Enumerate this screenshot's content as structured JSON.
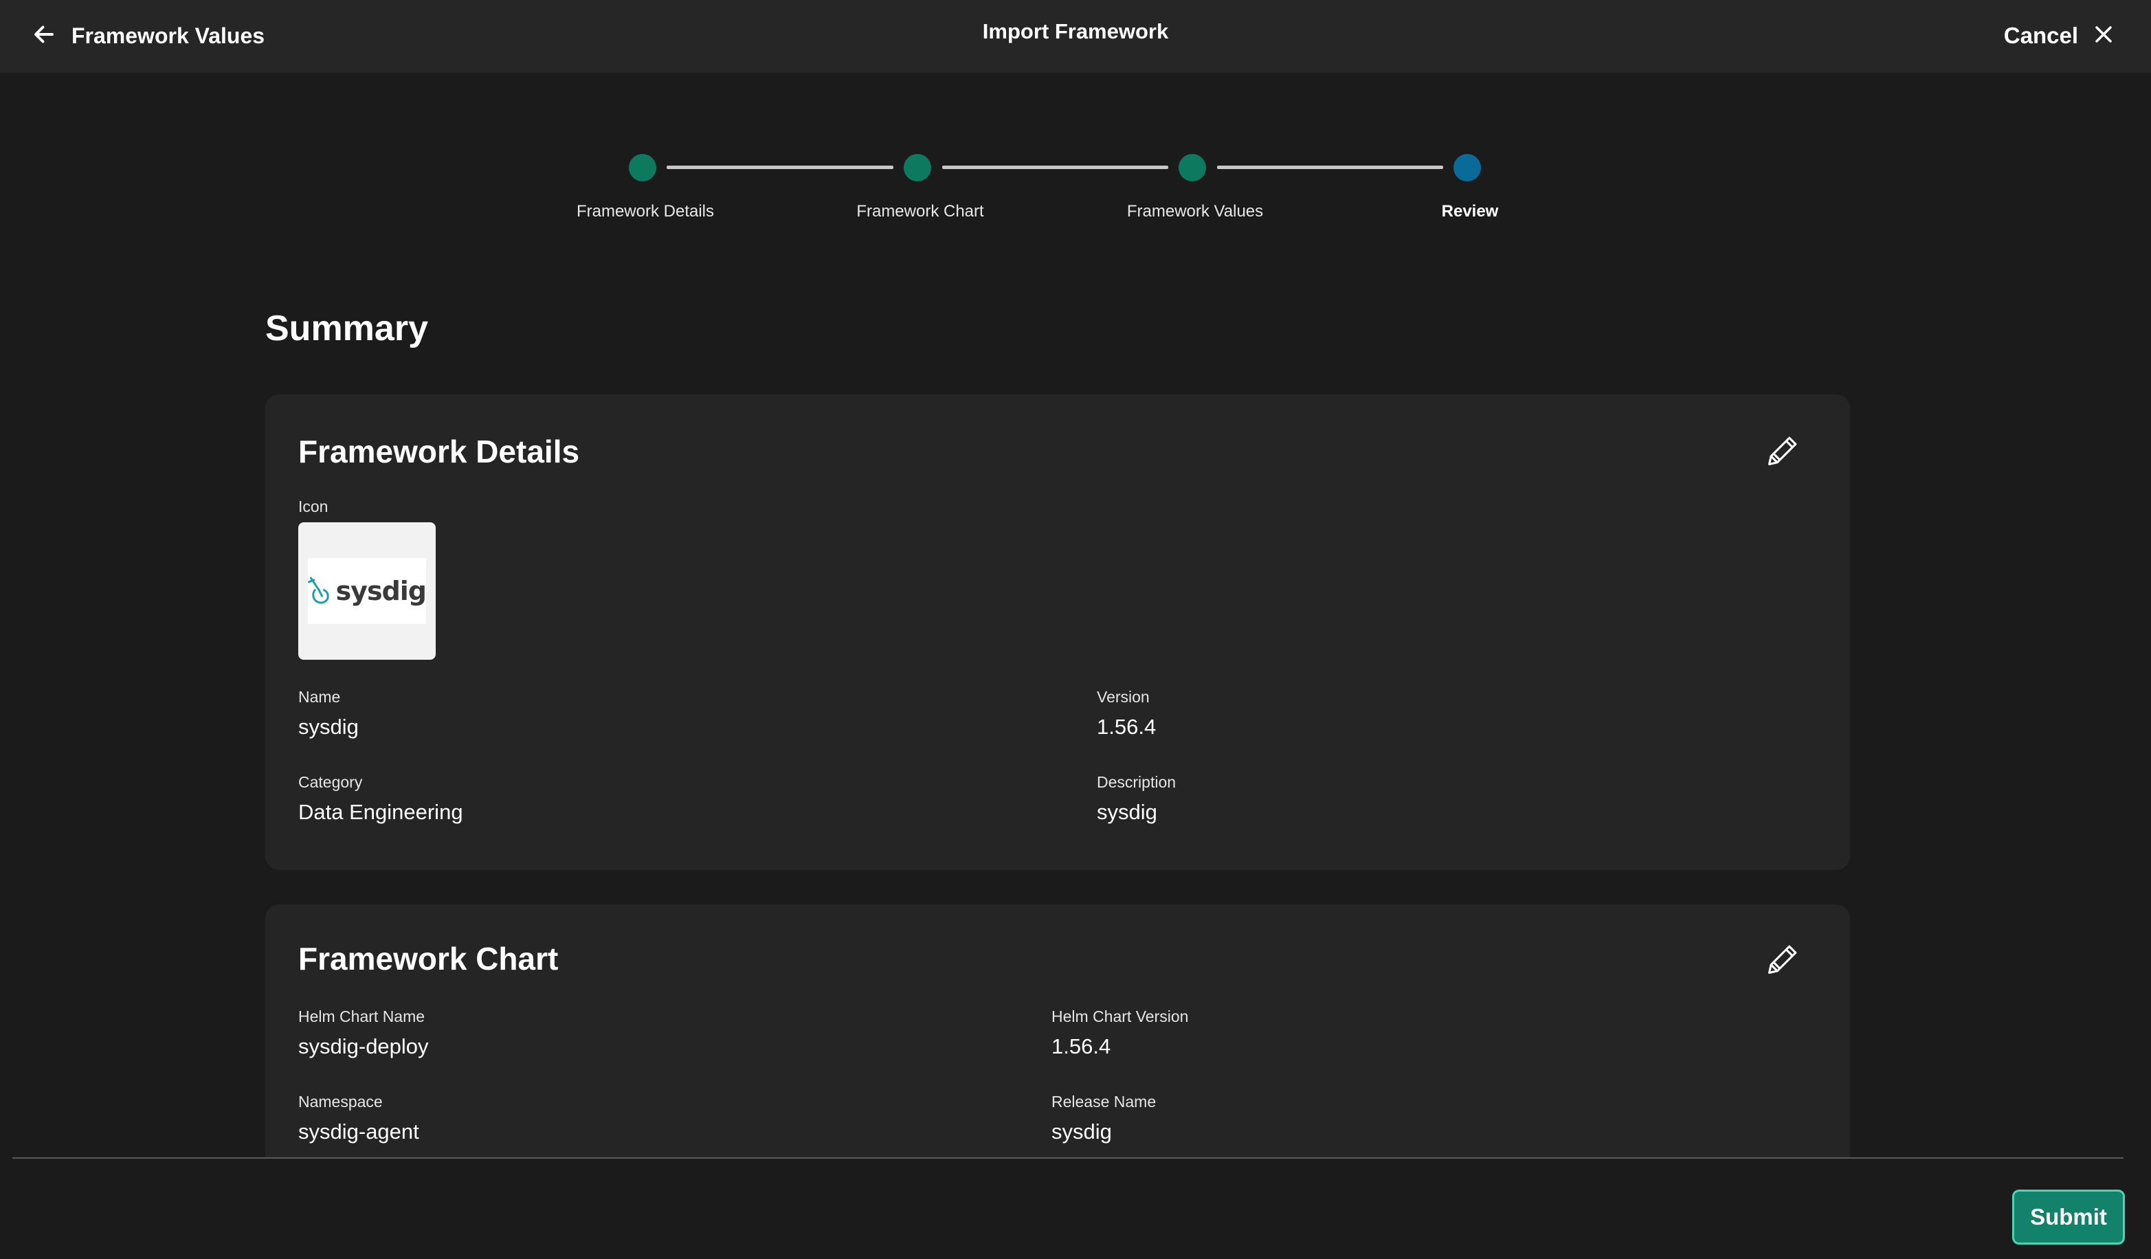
{
  "header": {
    "back_label": "Framework Values",
    "title": "Import Framework",
    "cancel_label": "Cancel"
  },
  "stepper": {
    "steps": [
      {
        "label": "Framework Details",
        "state": "done"
      },
      {
        "label": "Framework Chart",
        "state": "done"
      },
      {
        "label": "Framework Values",
        "state": "done"
      },
      {
        "label": "Review",
        "state": "active"
      }
    ]
  },
  "summary": {
    "title": "Summary",
    "details": {
      "title": "Framework Details",
      "icon_label": "Icon",
      "icon_logo_text": "sysdig",
      "name_label": "Name",
      "name_value": "sysdig",
      "version_label": "Version",
      "version_value": "1.56.4",
      "category_label": "Category",
      "category_value": "Data Engineering",
      "description_label": "Description",
      "description_value": "sysdig"
    },
    "chart": {
      "title": "Framework Chart",
      "helm_name_label": "Helm Chart Name",
      "helm_name_value": "sysdig-deploy",
      "helm_version_label": "Helm Chart Version",
      "helm_version_value": "1.56.4",
      "namespace_label": "Namespace",
      "namespace_value": "sysdig-agent",
      "release_label": "Release Name",
      "release_value": "sysdig"
    }
  },
  "footer": {
    "submit_label": "Submit"
  },
  "colors": {
    "step_done": "#0d7a5f",
    "step_active": "#0a6b99",
    "submit_bg": "#12826a",
    "submit_border": "#4fd3b2",
    "logo_teal": "#1a9bb0"
  }
}
